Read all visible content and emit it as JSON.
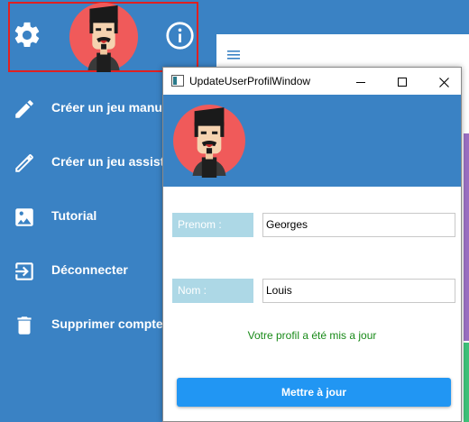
{
  "sidebar": {
    "items": [
      {
        "label": "Créer un jeu manuel",
        "icon": "pencil-icon"
      },
      {
        "label": "Créer un jeu assisté",
        "icon": "pencil-icon"
      },
      {
        "label": "Tutorial",
        "icon": "image-icon"
      },
      {
        "label": "Déconnecter",
        "icon": "logout-icon"
      },
      {
        "label": "Supprimer compte",
        "icon": "trash-icon"
      }
    ],
    "top_icons": [
      "gear-icon",
      "avatar",
      "info-icon"
    ]
  },
  "dialog": {
    "title": "UpdateUserProfilWindow",
    "controls": {
      "minimize": "—",
      "maximize": "☐",
      "close": "✕"
    },
    "fields": [
      {
        "label": "Prenom :",
        "value": "Georges"
      },
      {
        "label": "Nom :",
        "value": "Louis"
      }
    ],
    "status": "Votre profil a été mis a jour",
    "button": "Mettre à jour"
  },
  "colors": {
    "sidebar": "#3a82c4",
    "highlight_border": "#e02020",
    "field_label": "#add8e6",
    "status": "#188a18",
    "button": "#2196f3",
    "avatar_bg": "#f05a5a"
  }
}
